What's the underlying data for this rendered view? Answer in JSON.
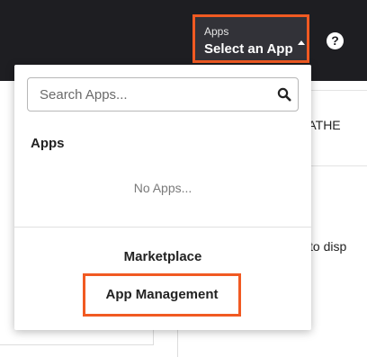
{
  "topbar": {
    "app_switcher": {
      "caption": "Apps",
      "value": "Select an App",
      "caret_icon": "caret-up-icon",
      "highlight_color": "#f15a22"
    },
    "help_icon": {
      "icon": "help-icon",
      "glyph": "?"
    }
  },
  "background": {
    "header_text": "EATHE",
    "body_text": "to disp"
  },
  "dropdown": {
    "search": {
      "placeholder": "Search Apps...",
      "value": "",
      "icon": "search-icon"
    },
    "section_title": "Apps",
    "empty_text": "No Apps...",
    "links": {
      "marketplace": "Marketplace",
      "app_management": "App Management"
    }
  },
  "colors": {
    "topbar_bg": "#1e1e22",
    "switcher_bg": "#323238",
    "highlight": "#f15a22"
  }
}
